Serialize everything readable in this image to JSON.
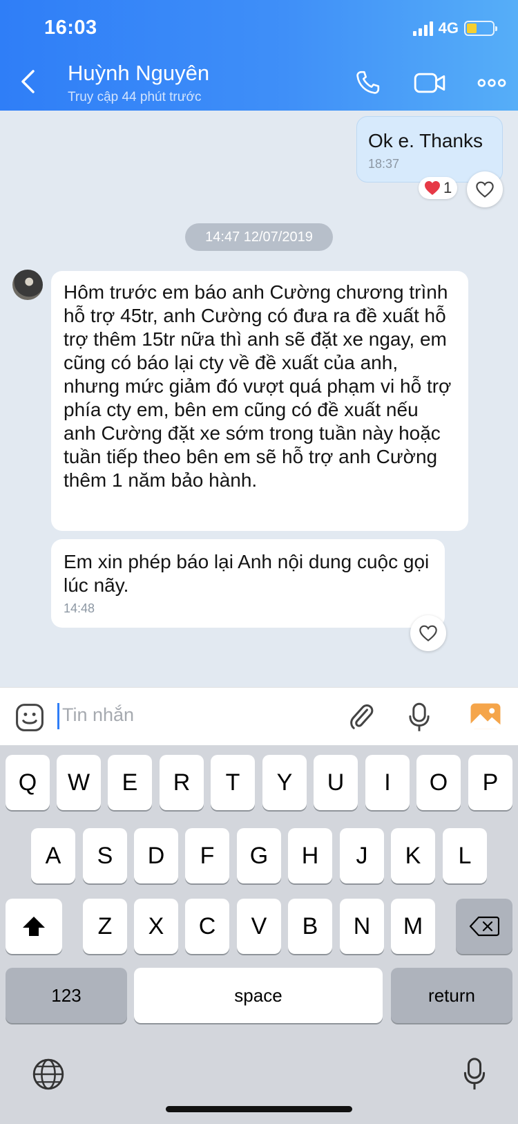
{
  "status_bar": {
    "time": "16:03",
    "network": "4G"
  },
  "header": {
    "contact_name": "Huỳnh Nguyên",
    "last_seen": "Truy cập 44 phút trước",
    "icons": [
      "back-chevron-icon",
      "phone-icon",
      "video-icon",
      "more-icon"
    ]
  },
  "messages": [
    {
      "direction": "out",
      "text": "Ok e. Thanks",
      "time": "18:37",
      "reaction": {
        "emoji": "heart",
        "count": "1"
      }
    },
    {
      "type": "date_separator",
      "text": "14:47 12/07/2019"
    },
    {
      "direction": "in",
      "text": "Hôm trước em báo anh Cường chương trình hỗ trợ 45tr, anh Cường có đưa ra đề xuất hỗ trợ thêm 15tr nữa thì anh sẽ đặt xe ngay, em cũng có báo lại cty về đề xuất của anh, nhưng mức giảm đó vượt quá phạm vi hỗ trợ phía cty em, bên em cũng có đề xuất nếu anh Cường đặt xe sớm trong tuần này hoặc tuần tiếp theo bên em sẽ hỗ trợ anh Cường thêm 1 năm bảo hành."
    },
    {
      "direction": "in",
      "text": "Em xin phép báo lại Anh nội dung cuộc gọi lúc nãy.",
      "time": "14:48"
    }
  ],
  "input": {
    "placeholder": "Tin nhắn"
  },
  "keyboard": {
    "row1": [
      "Q",
      "W",
      "E",
      "R",
      "T",
      "Y",
      "U",
      "I",
      "O",
      "P"
    ],
    "row2": [
      "A",
      "S",
      "D",
      "F",
      "G",
      "H",
      "J",
      "K",
      "L"
    ],
    "row3": [
      "Z",
      "X",
      "C",
      "V",
      "B",
      "N",
      "M"
    ],
    "numbers_label": "123",
    "space_label": "space",
    "return_label": "return"
  },
  "colors": {
    "header_start": "#2f7ef7",
    "header_end": "#56aef8",
    "outgoing_bubble": "#d7eafc",
    "chat_bg": "#e2e9f1",
    "reaction_heart": "#e63946"
  }
}
